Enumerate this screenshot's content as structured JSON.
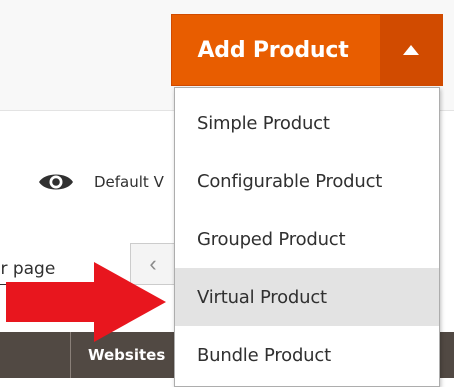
{
  "header": {
    "add_product_label": "Add Product"
  },
  "dropdown": {
    "items": [
      {
        "label": "Simple Product"
      },
      {
        "label": "Configurable Product"
      },
      {
        "label": "Grouped Product"
      },
      {
        "label": "Virtual Product",
        "highlighted": true
      },
      {
        "label": "Bundle Product"
      }
    ]
  },
  "view": {
    "default_view_text": "Default V"
  },
  "pager": {
    "per_page_text": "er page",
    "prev_symbol": "‹"
  },
  "grid": {
    "websites_header": "Websites"
  },
  "colors": {
    "primary": "#e85d00",
    "primary_dark": "#d14b00",
    "grid_header": "#514943",
    "arrow": "#e8161e",
    "highlight": "#e3e3e3"
  },
  "icons": {
    "view": "eye-icon",
    "toggle": "caret-up-icon",
    "annotation": "red-arrow-icon"
  }
}
